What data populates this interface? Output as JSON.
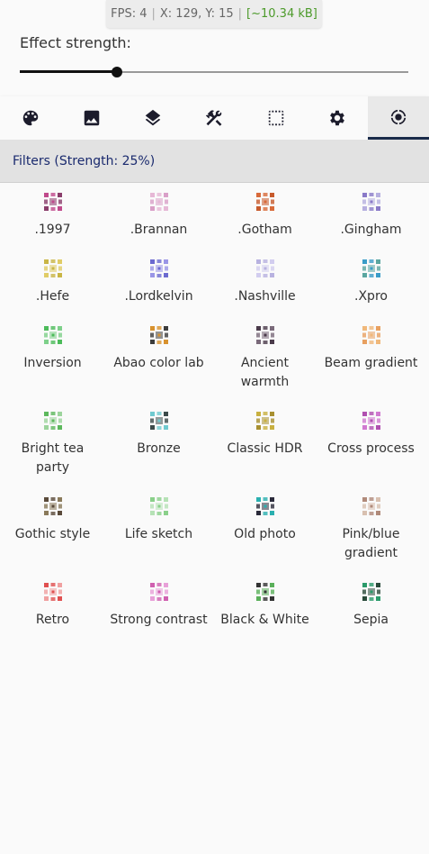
{
  "status": {
    "fps": "FPS: 4",
    "coords": "X: 129, Y: 15",
    "size": "[~10.34 kB]"
  },
  "effect": {
    "label": "Effect strength:",
    "strength": 0.25
  },
  "tabs": [
    {
      "icon": "palette-icon",
      "active": false
    },
    {
      "icon": "image-icon",
      "active": false
    },
    {
      "icon": "layers-icon",
      "active": false
    },
    {
      "icon": "tools-icon",
      "active": false
    },
    {
      "icon": "selection-icon",
      "active": false
    },
    {
      "icon": "gear-icon",
      "active": false
    },
    {
      "icon": "filter-target-icon",
      "active": true
    }
  ],
  "section": {
    "title": "Filters (Strength: 25%)"
  },
  "filters": [
    {
      "name": ".1997",
      "colors": [
        "#c04a8c",
        "#8a3d6b"
      ]
    },
    {
      "name": ".Brannan",
      "colors": [
        "#e6b8d6",
        "#d9a0c8"
      ]
    },
    {
      "name": ".Gotham",
      "colors": [
        "#d86a3a",
        "#c75a2c"
      ]
    },
    {
      "name": ".Gingham",
      "colors": [
        "#8a7ac8",
        "#b7b0e0"
      ]
    },
    {
      "name": ".Hefe",
      "colors": [
        "#c9b545",
        "#e0cc66"
      ]
    },
    {
      "name": ".Lordkelvin",
      "colors": [
        "#6c6ad0",
        "#9a96e6"
      ]
    },
    {
      "name": ".Nashville",
      "colors": [
        "#b8b2e0",
        "#d2cdef"
      ]
    },
    {
      "name": ".Xpro",
      "colors": [
        "#3a9cc8",
        "#5aa6a0"
      ]
    },
    {
      "name": "Inversion",
      "colors": [
        "#4cbb5a",
        "#7ed08a"
      ]
    },
    {
      "name": "Abao color lab",
      "colors": [
        "#d8922e",
        "#3c3c3c"
      ]
    },
    {
      "name": "Ancient warmth",
      "colors": [
        "#4a3a4a",
        "#7a6a7a"
      ]
    },
    {
      "name": "Beam gradient",
      "colors": [
        "#f0b87a",
        "#e8a060"
      ]
    },
    {
      "name": "Bright tea party",
      "colors": [
        "#5cb85c",
        "#9cd49c"
      ]
    },
    {
      "name": "Bronze",
      "colors": [
        "#70cad0",
        "#3c4a4a"
      ]
    },
    {
      "name": "Classic HDR",
      "colors": [
        "#c8b040",
        "#a89030"
      ]
    },
    {
      "name": "Cross process",
      "colors": [
        "#b050b0",
        "#d07ad0"
      ]
    },
    {
      "name": "Gothic style",
      "colors": [
        "#5a4a3a",
        "#8a7a5a"
      ]
    },
    {
      "name": "Life sketch",
      "colors": [
        "#8ad08a",
        "#b6e2b6"
      ]
    },
    {
      "name": "Old photo",
      "colors": [
        "#2ab0b0",
        "#2a2a3a"
      ]
    },
    {
      "name": "Pink/blue gradient",
      "colors": [
        "#b08a7a",
        "#d8c0b0"
      ]
    },
    {
      "name": "Retro",
      "colors": [
        "#e05050",
        "#f0a0a0"
      ]
    },
    {
      "name": "Strong contrast",
      "colors": [
        "#d060b0",
        "#e8a0d8"
      ]
    },
    {
      "name": "Black & White",
      "colors": [
        "#333333",
        "#5ab05a"
      ]
    },
    {
      "name": "Sepia",
      "colors": [
        "#2a9a6a",
        "#2a4a3a"
      ]
    }
  ]
}
